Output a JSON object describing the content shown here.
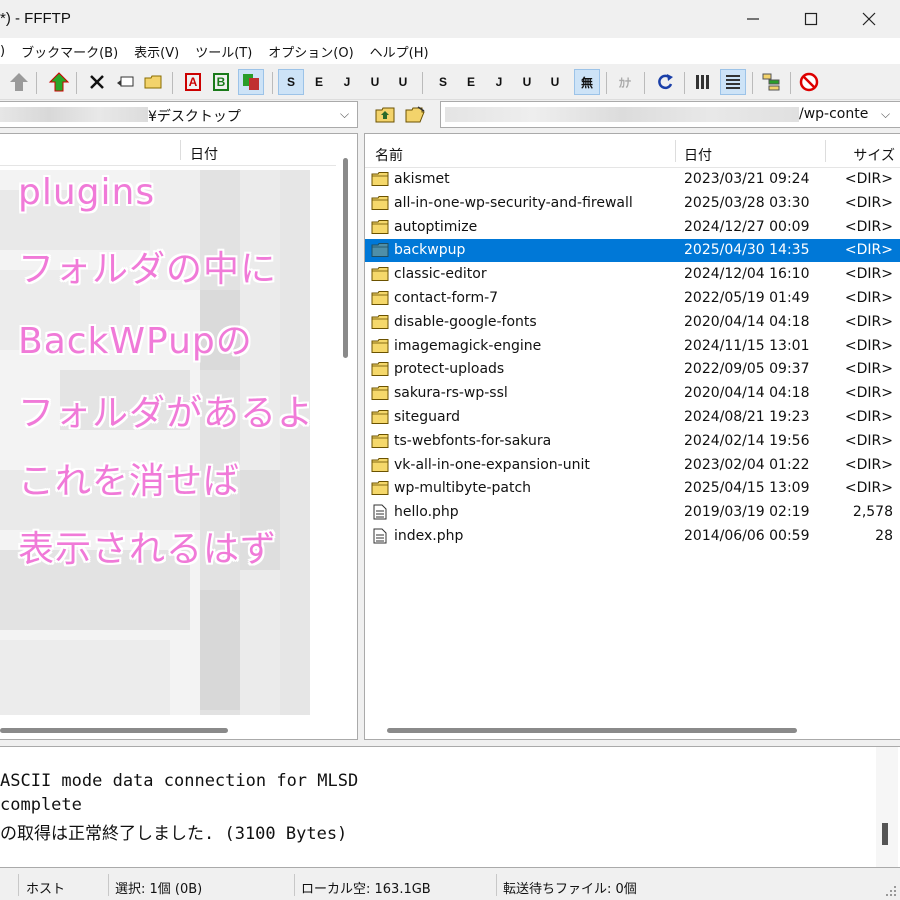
{
  "window": {
    "title": "*) - FFFTP",
    "minimize_icon": "minimize-icon",
    "maximize_icon": "maximize-icon",
    "close_icon": "close-icon"
  },
  "menu": [
    ")",
    "ブックマーク(B)",
    "表示(V)",
    "ツール(T)",
    "オプション(O)",
    "ヘルプ(H)"
  ],
  "toolbar": {
    "text_buttons": {
      "s_jis_1": "S",
      "euc_1": "E",
      "jis_1": "J",
      "utf8_1": "U",
      "utf8bom_1": "U",
      "s_jis_2": "S",
      "euc_2": "E",
      "jis_2": "J",
      "utf8_2": "U",
      "utf8bom_2": "U",
      "mu": "無",
      "kana": "ｶﾅ",
      "ascii": "A",
      "binary": "B"
    }
  },
  "left_pane": {
    "path_suffix": "¥デスクトップ",
    "column_date": "日付"
  },
  "annotation": {
    "lines": [
      "plugins",
      "フォルダの中に",
      "BackWPupの",
      "フォルダがあるよ",
      "これを消せば",
      "表示されるはず"
    ],
    "color": "#f07ad8"
  },
  "right_pane": {
    "path_suffix": "/wp-conte",
    "columns": {
      "name": "名前",
      "date": "日付",
      "size": "サイズ"
    },
    "files": [
      {
        "name": "akismet",
        "date": "2023/03/21 09:24",
        "size": "<DIR>",
        "type": "folder"
      },
      {
        "name": "all-in-one-wp-security-and-firewall",
        "date": "2025/03/28 03:30",
        "size": "<DIR>",
        "type": "folder"
      },
      {
        "name": "autoptimize",
        "date": "2024/12/27 00:09",
        "size": "<DIR>",
        "type": "folder"
      },
      {
        "name": "backwpup",
        "date": "2025/04/30 14:35",
        "size": "<DIR>",
        "type": "folder",
        "selected": true
      },
      {
        "name": "classic-editor",
        "date": "2024/12/04 16:10",
        "size": "<DIR>",
        "type": "folder"
      },
      {
        "name": "contact-form-7",
        "date": "2022/05/19 01:49",
        "size": "<DIR>",
        "type": "folder"
      },
      {
        "name": "disable-google-fonts",
        "date": "2020/04/14 04:18",
        "size": "<DIR>",
        "type": "folder"
      },
      {
        "name": "imagemagick-engine",
        "date": "2024/11/15 13:01",
        "size": "<DIR>",
        "type": "folder"
      },
      {
        "name": "protect-uploads",
        "date": "2022/09/05 09:37",
        "size": "<DIR>",
        "type": "folder"
      },
      {
        "name": "sakura-rs-wp-ssl",
        "date": "2020/04/14 04:18",
        "size": "<DIR>",
        "type": "folder"
      },
      {
        "name": "siteguard",
        "date": "2024/08/21 19:23",
        "size": "<DIR>",
        "type": "folder"
      },
      {
        "name": "ts-webfonts-for-sakura",
        "date": "2024/02/14 19:56",
        "size": "<DIR>",
        "type": "folder"
      },
      {
        "name": "vk-all-in-one-expansion-unit",
        "date": "2023/02/04 01:22",
        "size": "<DIR>",
        "type": "folder"
      },
      {
        "name": "wp-multibyte-patch",
        "date": "2025/04/15 13:09",
        "size": "<DIR>",
        "type": "folder"
      },
      {
        "name": "hello.php",
        "date": "2019/03/19 02:19",
        "size": "2,578",
        "type": "file"
      },
      {
        "name": "index.php",
        "date": "2014/06/06 00:59",
        "size": "28",
        "type": "file"
      }
    ],
    "selection_color": "#0078d7"
  },
  "log": [
    "ASCII mode data connection for MLSD",
    "complete",
    "の取得は正常終了しました. (3100 Bytes)"
  ],
  "status": {
    "host": "ホスト",
    "selection": "選択: 1個 (0B)",
    "local_free": "ローカル空: 163.1GB",
    "queue": "転送待ちファイル: 0個"
  }
}
